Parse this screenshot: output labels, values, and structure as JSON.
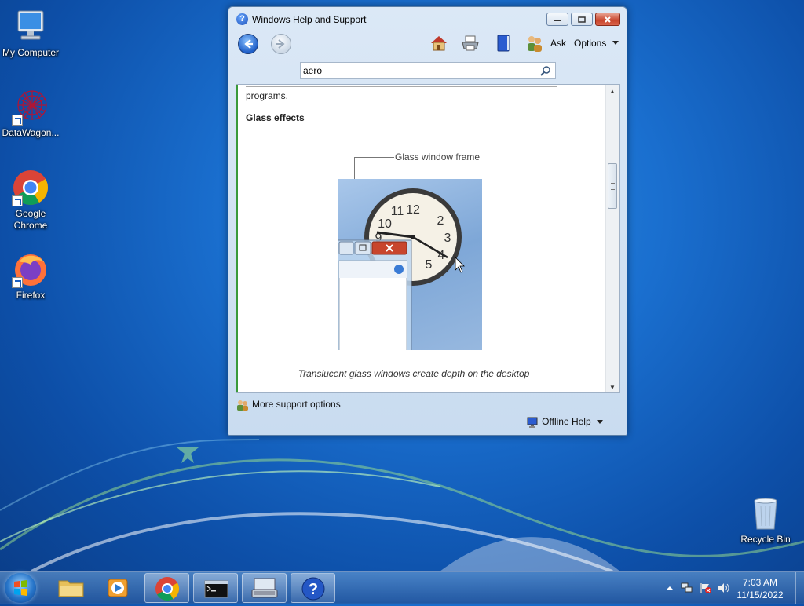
{
  "desktop": {
    "icons": [
      {
        "label": "My Computer"
      },
      {
        "label": "DataWagon..."
      },
      {
        "label": "Google Chrome"
      },
      {
        "label": "Firefox"
      },
      {
        "label": "Recycle Bin"
      }
    ]
  },
  "window": {
    "title": "Windows Help and Support",
    "toolbar": {
      "ask_label": "Ask",
      "options_label": "Options"
    },
    "search": {
      "value": "aero"
    },
    "content": {
      "partial_text": "programs.",
      "heading": "Glass effects",
      "callout": "Glass window frame",
      "caption": "Translucent glass windows create depth on the desktop"
    },
    "footer": {
      "more_support": "More support options",
      "offline_help": "Offline Help"
    }
  },
  "taskbar": {
    "time": "7:03 AM",
    "date": "11/15/2022"
  },
  "colors": {
    "accent": "#1f5fc8",
    "close_red": "#c8452d"
  }
}
